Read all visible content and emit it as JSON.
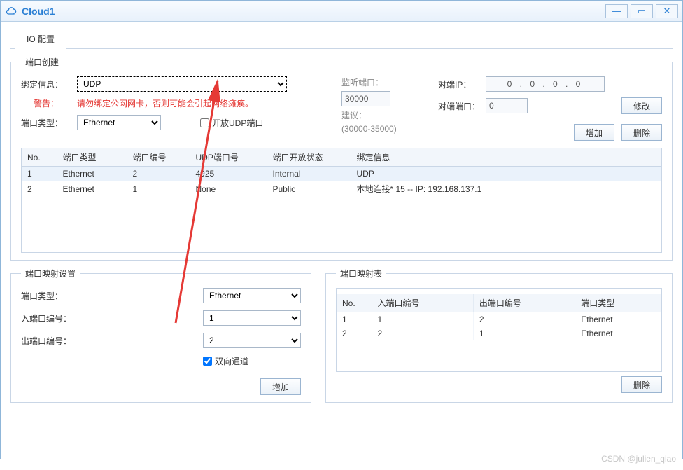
{
  "window": {
    "title": "Cloud1"
  },
  "tabs": {
    "io_config": "IO 配置"
  },
  "group_port_create": {
    "legend": "端口创建",
    "bind_label": "绑定信息：",
    "bind_value": "UDP",
    "warn_label": "警告：",
    "warn_text": "请勿绑定公网网卡，否则可能会引起网络瘫痪。",
    "port_type_label": "端口类型：",
    "port_type_value": "Ethernet",
    "open_udp_label": "开放UDP端口",
    "open_udp_checked": false,
    "listen_port_label": "监听端口：",
    "listen_port_value": "30000",
    "suggest_label": "建议：",
    "suggest_range": "(30000-35000)",
    "peer_ip_label": "对端IP：",
    "peer_ip_value": "0 . 0 . 0 . 0",
    "peer_port_label": "对端端口：",
    "peer_port_value": "0",
    "btn_modify": "修改",
    "btn_add": "增加",
    "btn_delete": "删除",
    "table": {
      "headers": [
        "No.",
        "端口类型",
        "端口编号",
        "UDP端口号",
        "端口开放状态",
        "绑定信息"
      ],
      "rows": [
        [
          "1",
          "Ethernet",
          "2",
          "4925",
          "Internal",
          "UDP"
        ],
        [
          "2",
          "Ethernet",
          "1",
          "None",
          "Public",
          "本地连接* 15 -- IP: 192.168.137.1"
        ]
      ],
      "selected_row": 0
    }
  },
  "group_map_settings": {
    "legend": "端口映射设置",
    "port_type_label": "端口类型：",
    "port_type_value": "Ethernet",
    "in_port_label": "入端口编号：",
    "in_port_value": "1",
    "out_port_label": "出端口编号：",
    "out_port_value": "2",
    "bidir_label": "双向通道",
    "bidir_checked": true,
    "btn_add": "增加"
  },
  "group_map_table": {
    "legend": "端口映射表",
    "headers": [
      "No.",
      "入端口编号",
      "出端口编号",
      "端口类型"
    ],
    "rows": [
      [
        "1",
        "1",
        "2",
        "Ethernet"
      ],
      [
        "2",
        "2",
        "1",
        "Ethernet"
      ]
    ],
    "btn_delete": "删除"
  },
  "watermark": "CSDN @julien_qiao"
}
